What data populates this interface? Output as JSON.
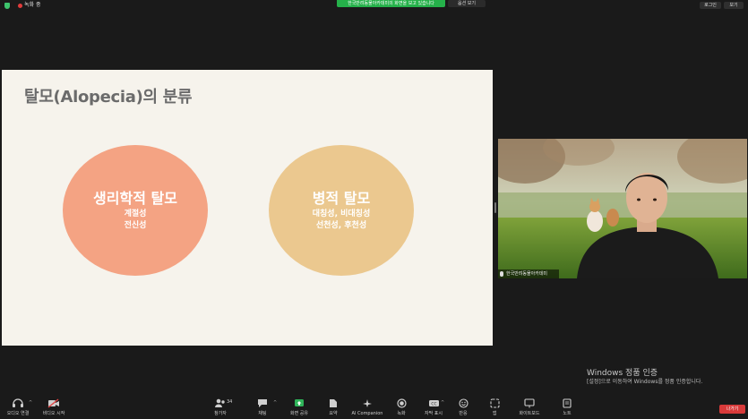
{
  "topbar": {
    "recording_label": "녹화 중",
    "share_banner": "한국반려동물아카데미의 화면을 보고 있습니다",
    "view_options": "옵션 보기",
    "exit_fullscreen": "로그인",
    "view": "보기"
  },
  "slide": {
    "title": "탈모(Alopecia)의 분류",
    "circles": [
      {
        "title": "생리학적 탈모",
        "lines": [
          "계절성",
          "전신성"
        ]
      },
      {
        "title": "병적 탈모",
        "lines": [
          "대칭성, 비대칭성",
          "선천성, 후천성"
        ]
      }
    ],
    "colors": {
      "circle1": "#f4a383",
      "circle2": "#ebc88f",
      "background": "#f6f3ec"
    }
  },
  "video": {
    "participant_name": "한국반려동물아카데미"
  },
  "watermark": {
    "title": "Windows 정품 인증",
    "subtitle": "[설정]으로 이동하여 Windows를 정품 인증합니다."
  },
  "toolbar": {
    "audio": "오디오 연결",
    "video": "비디오 시작",
    "participants": "참가자",
    "participants_count": "34",
    "chat": "채팅",
    "share": "화면 공유",
    "summary": "요약",
    "companion": "AI Companion",
    "record": "녹화",
    "captions": "자막 표시",
    "reactions": "반응",
    "apps": "앱",
    "whiteboard": "화이트보드",
    "notes": "노트",
    "exit": "나가기"
  }
}
